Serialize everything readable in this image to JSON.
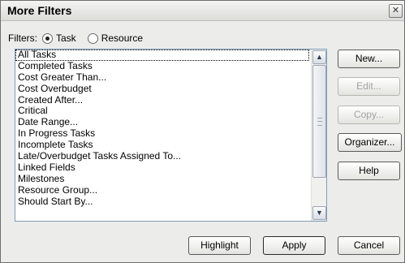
{
  "window": {
    "title": "More Filters"
  },
  "filters": {
    "label": "Filters:",
    "options": [
      {
        "label": "Task",
        "checked": true
      },
      {
        "label": "Resource",
        "checked": false
      }
    ]
  },
  "list": {
    "items": [
      "All Tasks",
      "Completed Tasks",
      "Cost Greater Than...",
      "Cost Overbudget",
      "Created After...",
      "Critical",
      "Date Range...",
      "In Progress Tasks",
      "Incomplete Tasks",
      "Late/Overbudget Tasks Assigned To...",
      "Linked Fields",
      "Milestones",
      "Resource Group...",
      "Should Start By..."
    ],
    "selected_index": 0
  },
  "side_buttons": {
    "new": "New...",
    "edit": "Edit...",
    "copy": "Copy...",
    "organizer": "Organizer...",
    "help": "Help"
  },
  "bottom_buttons": {
    "highlight": "Highlight",
    "apply": "Apply",
    "cancel": "Cancel"
  },
  "icons": {
    "close": "close-icon",
    "scroll_up": "arrow-up-icon",
    "scroll_down": "arrow-down-icon"
  }
}
